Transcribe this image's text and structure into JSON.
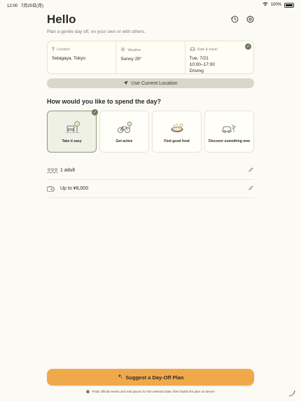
{
  "status_bar": {
    "time": "12:00",
    "date": "7月20日(月)",
    "battery": "100%"
  },
  "header": {
    "title": "Hello",
    "subtitle": "Plan a gentle day off, on your own or with others."
  },
  "info": {
    "location": {
      "label": "Location",
      "value": "Setagaya, Tokyo"
    },
    "weather": {
      "label": "Weather",
      "value": "Sunny 29°"
    },
    "date_travel": {
      "label": "Date & travel",
      "date": "Tue, 7/21",
      "time": "10:00–17:00",
      "mode": "Driving"
    }
  },
  "location_button": {
    "label": "Use Current Location"
  },
  "section": {
    "title": "How would you like to spend the day?"
  },
  "activities": [
    {
      "label": "Take it easy",
      "selected": true
    },
    {
      "label": "Get active",
      "selected": false
    },
    {
      "label": "Find good food",
      "selected": false
    },
    {
      "label": "Discover something new",
      "selected": false
    }
  ],
  "people": {
    "value": "1 adult"
  },
  "budget": {
    "value": "Up to ¥8,000"
  },
  "suggest_button": {
    "label": "Suggest a Day-Off Plan"
  },
  "footnote": "Finds official events and real places for the selected date, then builds the plan on device",
  "colors": {
    "accent": "#f0a94a",
    "primary_green": "#6b7d59",
    "background": "#fbfaf5"
  }
}
